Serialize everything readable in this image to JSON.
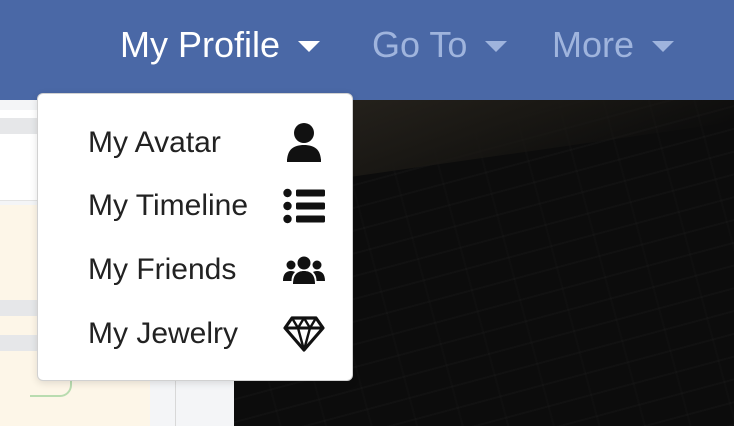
{
  "navbar": {
    "background": "#4a68a6",
    "items": [
      {
        "label": "My Profile",
        "active": true
      },
      {
        "label": "Go To",
        "active": false
      },
      {
        "label": "More",
        "active": false
      }
    ]
  },
  "dropdown": {
    "items": [
      {
        "label": "My Avatar",
        "icon": "user-icon"
      },
      {
        "label": "My Timeline",
        "icon": "list-icon"
      },
      {
        "label": "My Friends",
        "icon": "users-icon"
      },
      {
        "label": "My Jewelry",
        "icon": "gem-icon"
      }
    ]
  }
}
